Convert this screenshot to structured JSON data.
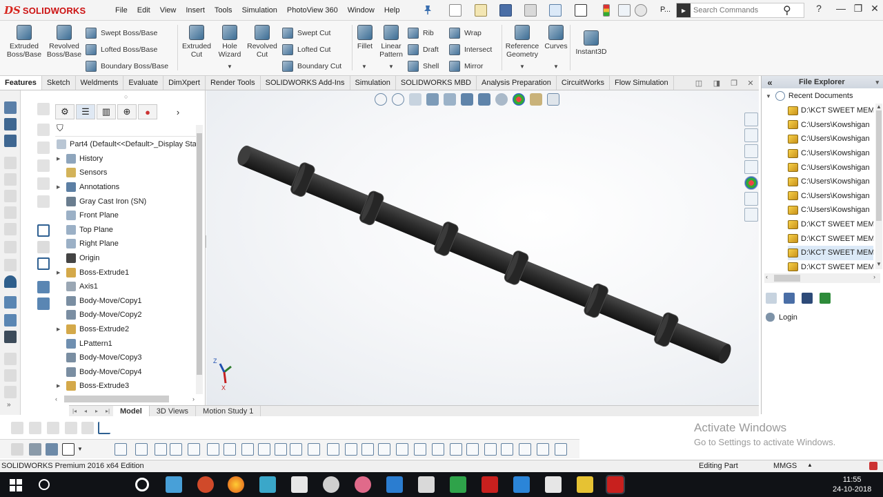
{
  "app": {
    "logo_ds": "DS",
    "logo_text": "SOLIDWORKS",
    "menus": [
      "File",
      "Edit",
      "View",
      "Insert",
      "Tools",
      "Simulation",
      "PhotoView 360",
      "Window",
      "Help"
    ],
    "quick_access_more": "P..."
  },
  "search": {
    "placeholder": "Search Commands"
  },
  "window_buttons": {
    "help": "?",
    "minimize": "—",
    "restore": "❐",
    "close": "✕"
  },
  "ribbon": {
    "extruded_boss": "Extruded Boss/Base",
    "revolved_boss": "Revolved Boss/Base",
    "swept_boss": "Swept Boss/Base",
    "lofted_boss": "Lofted Boss/Base",
    "boundary_boss": "Boundary Boss/Base",
    "extruded_cut": "Extruded Cut",
    "hole_wizard": "Hole Wizard",
    "revolved_cut": "Revolved Cut",
    "swept_cut": "Swept Cut",
    "lofted_cut": "Lofted Cut",
    "boundary_cut": "Boundary Cut",
    "fillet": "Fillet",
    "linear_pattern": "Linear Pattern",
    "rib": "Rib",
    "draft": "Draft",
    "shell": "Shell",
    "wrap": "Wrap",
    "intersect": "Intersect",
    "mirror": "Mirror",
    "reference_geometry": "Reference Geometry",
    "curves": "Curves",
    "instant3d": "Instant3D"
  },
  "tabs": [
    "Features",
    "Sketch",
    "Weldments",
    "Evaluate",
    "DimXpert",
    "Render Tools",
    "SOLIDWORKS Add-Ins",
    "Simulation",
    "SOLIDWORKS MBD",
    "Analysis Preparation",
    "CircuitWorks",
    "Flow Simulation"
  ],
  "active_tab": "Features",
  "feature_tree": {
    "root": "Part4  (Default<<Default>_Display Sta",
    "nodes": [
      {
        "label": "History",
        "expandable": true,
        "icon": "history-icon"
      },
      {
        "label": "Sensors",
        "expandable": false,
        "icon": "sensors-icon"
      },
      {
        "label": "Annotations",
        "expandable": true,
        "icon": "annotations-icon"
      },
      {
        "label": "Gray Cast Iron (SN)",
        "expandable": false,
        "icon": "material-icon"
      },
      {
        "label": "Front Plane",
        "expandable": false,
        "icon": "plane-icon"
      },
      {
        "label": "Top Plane",
        "expandable": false,
        "icon": "plane-icon"
      },
      {
        "label": "Right Plane",
        "expandable": false,
        "icon": "plane-icon"
      },
      {
        "label": "Origin",
        "expandable": false,
        "icon": "origin-icon"
      },
      {
        "label": "Boss-Extrude1",
        "expandable": true,
        "icon": "extrude-icon"
      },
      {
        "label": "Axis1",
        "expandable": false,
        "icon": "axis-icon"
      },
      {
        "label": "Body-Move/Copy1",
        "expandable": false,
        "icon": "move-copy-icon"
      },
      {
        "label": "Body-Move/Copy2",
        "expandable": false,
        "icon": "move-copy-icon"
      },
      {
        "label": "Boss-Extrude2",
        "expandable": true,
        "icon": "extrude-icon"
      },
      {
        "label": "LPattern1",
        "expandable": false,
        "icon": "pattern-icon"
      },
      {
        "label": "Body-Move/Copy3",
        "expandable": false,
        "icon": "move-copy-icon"
      },
      {
        "label": "Body-Move/Copy4",
        "expandable": false,
        "icon": "move-copy-icon"
      },
      {
        "label": "Boss-Extrude3",
        "expandable": true,
        "icon": "extrude-icon"
      }
    ]
  },
  "model_tabs": [
    "Model",
    "3D Views",
    "Motion Study 1"
  ],
  "active_model_tab": "Model",
  "task_pane": {
    "title": "File Explorer",
    "collapse": "«",
    "recent": "Recent Documents",
    "files": [
      "D:\\KCT SWEET MEM",
      "C:\\Users\\Kowshigan",
      "C:\\Users\\Kowshigan",
      "C:\\Users\\Kowshigan",
      "C:\\Users\\Kowshigan",
      "C:\\Users\\Kowshigan",
      "C:\\Users\\Kowshigan",
      "C:\\Users\\Kowshigan",
      "D:\\KCT SWEET MEM",
      "D:\\KCT SWEET MEM",
      "D:\\KCT SWEET MEM",
      "D:\\KCT SWEET MEM"
    ],
    "selected_index": 10,
    "login": "Login"
  },
  "triad": {
    "y": "Y",
    "z": "Z",
    "x": "X"
  },
  "status": {
    "edition": "SOLIDWORKS Premium 2016 x64 Edition",
    "mode": "Editing Part",
    "units": "MMGS",
    "units_arrow": "▲"
  },
  "watermark": {
    "line1": "Activate Windows",
    "line2": "Go to Settings to activate Windows."
  },
  "clock": {
    "time": "11:55",
    "date": "24-10-2018"
  },
  "colors": {
    "brand_red": "#d7261e",
    "model_body": "#2b2b2b",
    "taskbar_bg": "#101216",
    "selection": "#dbe9f7"
  }
}
